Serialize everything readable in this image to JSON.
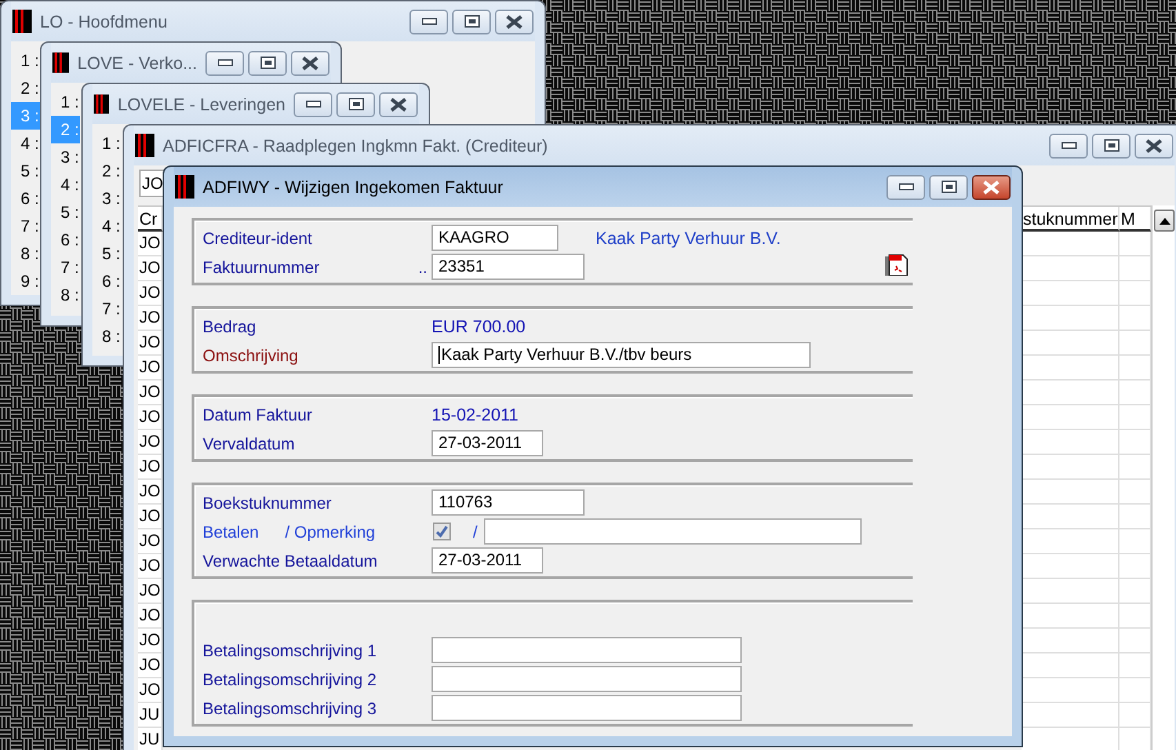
{
  "windows": [
    {
      "kind": "menu",
      "title": "LO - Hoofdmenu",
      "active": false,
      "items": [
        {
          "label": "1 :",
          "selected": false
        },
        {
          "label": "2 :",
          "selected": false
        },
        {
          "label": "3 :",
          "selected": true
        },
        {
          "label": "4 :",
          "selected": false
        },
        {
          "label": "5 :",
          "selected": false
        },
        {
          "label": "6 :",
          "selected": false
        },
        {
          "label": "7 :",
          "selected": false
        },
        {
          "label": "8 :",
          "selected": false
        },
        {
          "label": "9 :",
          "selected": false
        }
      ]
    },
    {
      "kind": "menu",
      "title": "LOVE - Verko...",
      "active": false,
      "items": [
        {
          "label": "1 :",
          "selected": false
        },
        {
          "label": "2 :",
          "selected": true
        },
        {
          "label": "3 :",
          "selected": false
        },
        {
          "label": "4 :",
          "selected": false
        },
        {
          "label": "5 :",
          "selected": false
        },
        {
          "label": "6 :",
          "selected": false
        },
        {
          "label": "7 :",
          "selected": false
        },
        {
          "label": "8 :",
          "selected": false
        }
      ]
    },
    {
      "kind": "menu",
      "title": "LOVELE - Leveringen",
      "active": false,
      "items": [
        {
          "label": "1 :",
          "selected": false
        },
        {
          "label": "2 :",
          "selected": false
        },
        {
          "label": "3 :",
          "selected": false
        },
        {
          "label": "4 :",
          "selected": false
        },
        {
          "label": "5 :",
          "selected": false
        },
        {
          "label": "6 :",
          "selected": false
        },
        {
          "label": "7 :",
          "selected": false
        },
        {
          "label": "8 :",
          "selected": false
        }
      ]
    },
    {
      "kind": "grid",
      "title": "ADFICFRA - Raadplegen Ingkmn Fakt. (Crediteur)",
      "active": false,
      "filter_value": "JO",
      "columns": [
        "Cr",
        "stuknummer",
        "M"
      ],
      "rows": [
        {
          "column_1": "JO"
        },
        {
          "column_1": "JO"
        },
        {
          "column_1": "JO"
        },
        {
          "column_1": "JO"
        },
        {
          "column_1": "JO"
        },
        {
          "column_1": "JO"
        },
        {
          "column_1": "JO"
        },
        {
          "column_1": "JO"
        },
        {
          "column_1": "JO"
        },
        {
          "column_1": "JO"
        },
        {
          "column_1": "JO"
        },
        {
          "column_1": "JO"
        },
        {
          "column_1": "JO"
        },
        {
          "column_1": "JO"
        },
        {
          "column_1": "JO"
        },
        {
          "column_1": "JO"
        },
        {
          "column_1": "JO"
        },
        {
          "column_1": "JO"
        },
        {
          "column_1": "JO"
        },
        {
          "column_1": "JU"
        },
        {
          "column_1": "JU"
        }
      ]
    },
    {
      "kind": "form",
      "title": "ADFIWY - Wijzigen Ingekomen Faktuur",
      "active": true,
      "groups": [
        {
          "rows": [
            {
              "kind": "field",
              "label": "Crediteur-ident",
              "color": "#14149b",
              "value": "KAAGRO",
              "focused": false,
              "note": "Kaak Party Verhuur B.V."
            },
            {
              "kind": "field",
              "label": "Faktuurnummer",
              "color": "#14149b",
              "prefix": "..",
              "value": "23351",
              "focused": false
            }
          ]
        },
        {
          "rows": [
            {
              "kind": "text",
              "label": "Bedrag",
              "color": "#14149b",
              "value": "EUR 700.00"
            },
            {
              "kind": "field",
              "label": "Omschrijving",
              "color": "#8b1010",
              "value": "Kaak Party Verhuur B.V./tbv beurs",
              "focused": true
            }
          ]
        },
        {
          "rows": [
            {
              "kind": "text",
              "label": "Datum Faktuur",
              "color": "#14149b",
              "value": "15-02-2011"
            },
            {
              "kind": "field",
              "label": "Vervaldatum",
              "color": "#14149b",
              "value": "27-03-2011",
              "focused": false
            }
          ]
        },
        {
          "rows": [
            {
              "kind": "field",
              "label": "Boekstuknummer",
              "color": "#14149b",
              "value": "110763",
              "focused": false
            },
            {
              "kind": "check",
              "label": "Betalen",
              "label_2": "/ Opmerking",
              "color": "#1f3fd8",
              "checked": true,
              "separator": "/",
              "focused": false
            },
            {
              "kind": "field",
              "label": "Verwachte Betaaldatum",
              "color": "#14149b",
              "value": "27-03-2011",
              "focused": false
            }
          ]
        },
        {
          "rows": [
            {
              "kind": "field",
              "label": "Betalingsomschrijving 1",
              "color": "#14149b",
              "focused": false
            },
            {
              "kind": "field",
              "label": "Betalingsomschrijving 2",
              "color": "#14149b",
              "focused": false
            },
            {
              "kind": "field",
              "label": "Betalingsomschrijving 3",
              "color": "#14149b",
              "focused": false
            }
          ]
        }
      ]
    }
  ]
}
